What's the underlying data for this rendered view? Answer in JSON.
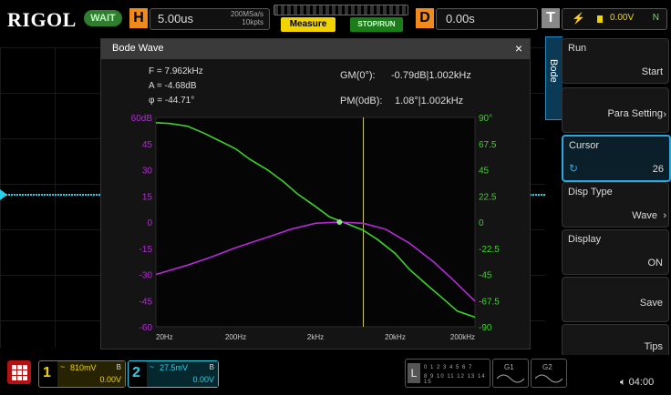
{
  "topbar": {
    "brand": "RIGOL",
    "status": "WAIT",
    "h_key": "H",
    "h_value": "5.00us",
    "sample_rate": "200MSa/s",
    "memory_depth": "10kpts",
    "measure_label": "Measure",
    "stoprun_label": "STOP/RUN",
    "d_key": "D",
    "d_value": "0.00s",
    "t_key": "T",
    "trigger_level": "0.00V",
    "trigger_mode": "N"
  },
  "bode": {
    "title": "Bode Wave",
    "close": "×",
    "cursor": {
      "freq": "F = 7.962kHz",
      "amp": "A = -4.68dB",
      "phase": "φ = -44.71°"
    },
    "gain_margin_label": "GM(0°):",
    "gain_margin_value": "-0.79dB|1.002kHz",
    "phase_margin_label": "PM(0dB):",
    "phase_margin_value": "1.08°|1.002kHz",
    "colors": {
      "gain": "#3ed12a",
      "phase": "#b42ad6",
      "axis_left": "#b42ad6",
      "axis_right": "#3ed12a",
      "cursor": "#c8c862"
    }
  },
  "chart_data": {
    "type": "line",
    "x_scale": "log",
    "x_ticks": [
      "20Hz",
      "200Hz",
      "2kHz",
      "20kHz",
      "200kHz"
    ],
    "x_tick_values": [
      20,
      200,
      2000,
      20000,
      200000
    ],
    "left_ticks": [
      "60dB",
      "45",
      "30",
      "15",
      "0",
      "-15",
      "-30",
      "-45",
      "-60"
    ],
    "right_ticks": [
      "90°",
      "67.5",
      "45",
      "22.5",
      "0",
      "-22.5",
      "-45",
      "-67.5",
      "-90"
    ],
    "ylim_gain": [
      -60,
      60
    ],
    "ylim_phase": [
      -90,
      90
    ],
    "cursor_x": 7962,
    "series": [
      {
        "axis": "gain",
        "x": [
          20,
          30,
          50,
          80,
          120,
          200,
          300,
          500,
          800,
          1200,
          2000,
          3000,
          5000,
          7962,
          12000,
          20000,
          30000,
          50000,
          80000,
          120000,
          200000
        ],
        "y": [
          57,
          56.5,
          55,
          51,
          47,
          42,
          36,
          30,
          23,
          16,
          9,
          3,
          -1,
          -4.7,
          -10,
          -18,
          -27,
          -36,
          -44,
          -51,
          -54.5
        ]
      },
      {
        "axis": "phase",
        "x": [
          20,
          50,
          100,
          200,
          500,
          1000,
          2000,
          4000,
          7962,
          15000,
          30000,
          60000,
          100000,
          200000
        ],
        "y": [
          -45,
          -37,
          -30,
          -22,
          -13,
          -6,
          -1,
          0,
          -1,
          -6,
          -18,
          -34,
          -48,
          -68
        ]
      }
    ]
  },
  "side": {
    "tab": "Bode",
    "items": [
      {
        "label": "Run",
        "value": "Start"
      },
      {
        "label": "",
        "value": "Para Setting"
      },
      {
        "label": "Cursor",
        "value": "26"
      },
      {
        "label": "Disp Type",
        "value": "Wave"
      },
      {
        "label": "Display",
        "value": "ON"
      },
      {
        "label": "",
        "value": "Save"
      },
      {
        "label": "",
        "value": "Tips"
      }
    ]
  },
  "bottom": {
    "ch1_num": "1",
    "ch1_scale": "810mV",
    "ch1_offset": "0.00V",
    "ch1_bw": "B",
    "ch2_num": "2",
    "ch2_scale": "27.5mV",
    "ch2_offset": "0.00V",
    "ch2_bw": "B",
    "l_key": "L",
    "digital_top": "0 1 2 3 4 5 6 7",
    "digital_bottom": "8 9 10 11 12 13 14 15",
    "g1_label": "G1",
    "g2_label": "G2",
    "time": "04:00"
  }
}
